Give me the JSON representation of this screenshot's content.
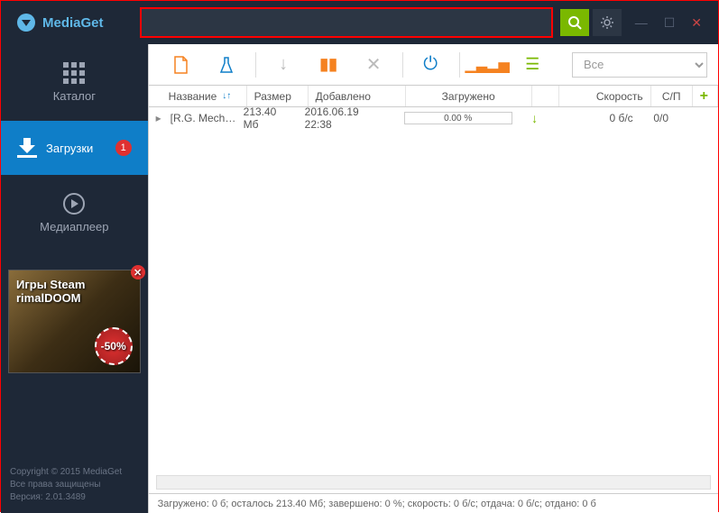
{
  "app": {
    "name": "MediaGet"
  },
  "sidebar": {
    "catalog": "Каталог",
    "downloads": "Загрузки",
    "downloads_badge": "1",
    "player": "Медиаплеер"
  },
  "ad": {
    "line1": "Игры Steam",
    "line2": "rimalDOOM",
    "discount": "-50%"
  },
  "footer": {
    "copyright": "Copyright © 2015 MediaGet",
    "rights": "Все права защищены",
    "version": "Версия: 2.01.3489"
  },
  "filter": {
    "selected": "Все"
  },
  "table": {
    "headers": {
      "name": "Название",
      "size": "Размер",
      "added": "Добавлено",
      "loaded": "Загружено",
      "speed": "Скорость",
      "sp": "С/П"
    },
    "rows": [
      {
        "name": "[R.G. Mech…",
        "size": "213.40 Мб",
        "added": "2016.06.19 22:38",
        "progress": "0.00 %",
        "speed": "0 б/с",
        "sp": "0/0"
      }
    ]
  },
  "statusbar": "Загружено: 0 б; осталось 213.40 Мб; завершено: 0 %; скорость: 0 б/с; отдача: 0 б/с; отдано: 0 б"
}
